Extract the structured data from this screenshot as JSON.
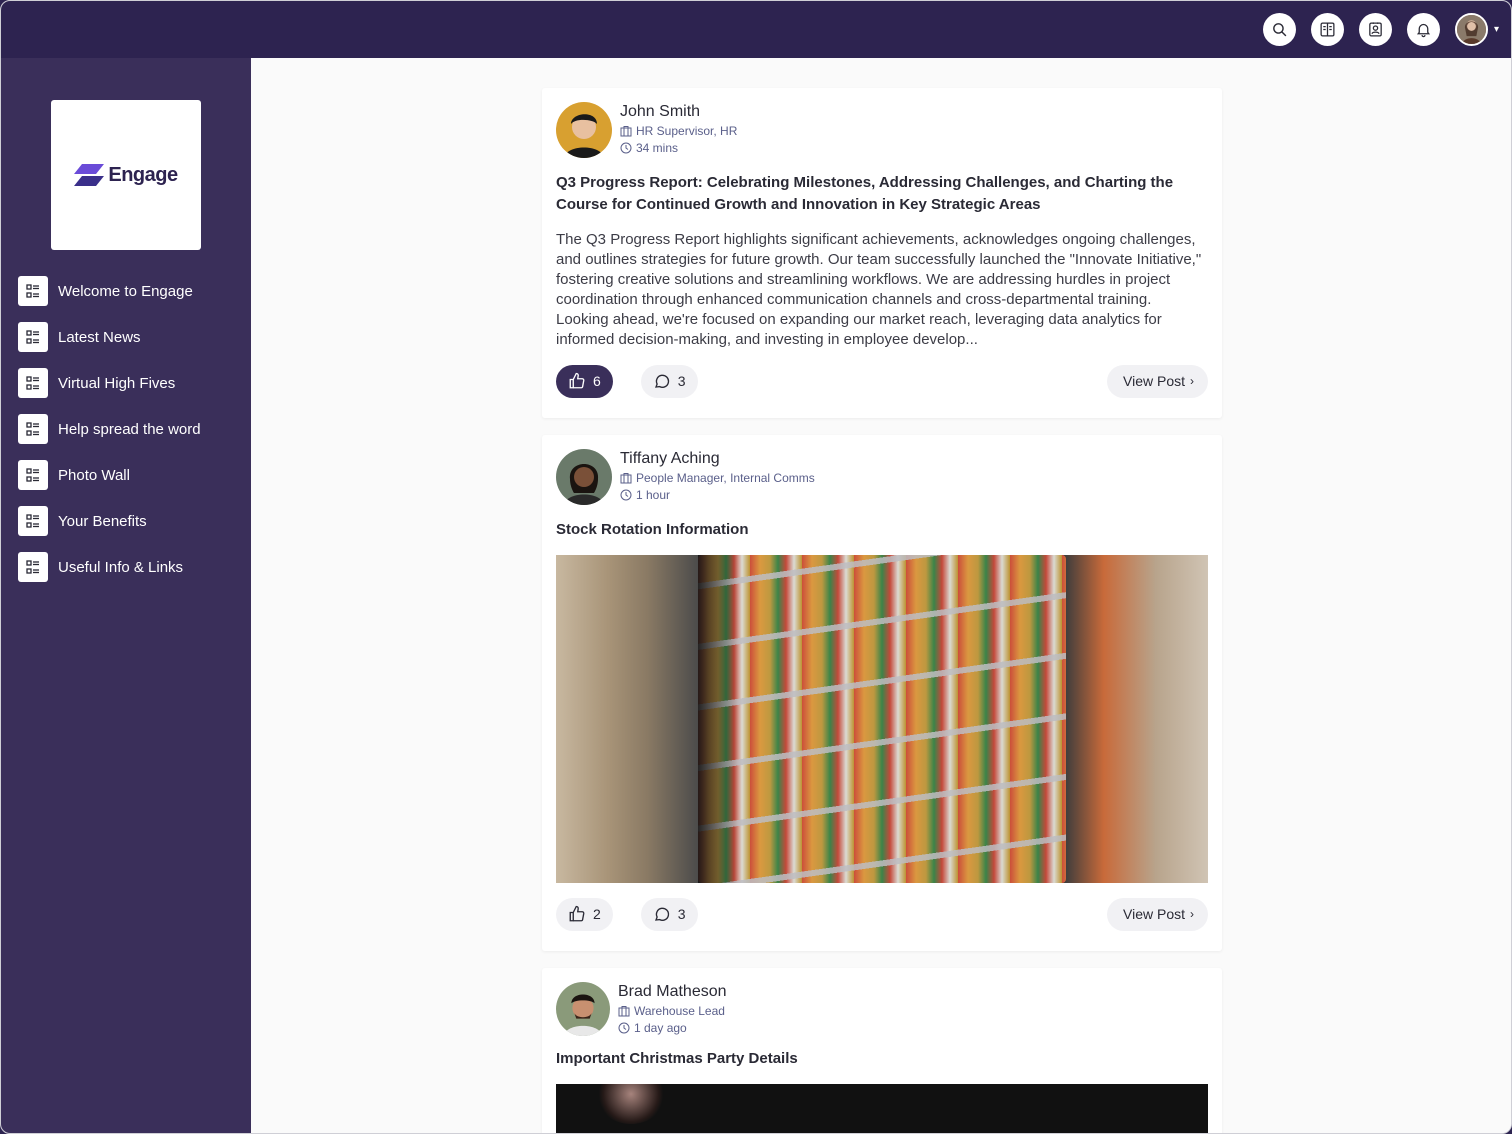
{
  "app": {
    "logo_text": "Engage"
  },
  "sidebar": {
    "items": [
      {
        "label": "Welcome to Engage"
      },
      {
        "label": "Latest News"
      },
      {
        "label": "Virtual High Fives"
      },
      {
        "label": "Help spread the word"
      },
      {
        "label": "Photo Wall"
      },
      {
        "label": "Your Benefits"
      },
      {
        "label": "Useful Info & Links"
      }
    ]
  },
  "topbar": {
    "icons": [
      "search-icon",
      "book-icon",
      "contact-card-icon",
      "bell-icon",
      "user-avatar"
    ],
    "caret": "▾"
  },
  "posts": [
    {
      "author": "John Smith",
      "role": "HR Supervisor, HR",
      "time": "34 mins",
      "title": "Q3 Progress Report: Celebrating Milestones, Addressing Challenges, and Charting the Course for Continued Growth and Innovation in Key Strategic Areas",
      "body": "The Q3 Progress Report highlights significant achievements, acknowledges ongoing challenges, and outlines strategies for future growth. Our team successfully launched the \"Innovate Initiative,\" fostering creative solutions and streamlining workflows. We are addressing hurdles in project coordination through enhanced communication channels and cross-departmental training. Looking ahead, we're focused on expanding our market reach, leveraging data analytics for informed decision-making, and investing in employee develop...",
      "likes": "6",
      "comments": "3",
      "liked": true,
      "view_label": "View Post"
    },
    {
      "author": "Tiffany Aching",
      "role": "People Manager, Internal Comms",
      "time": "1 hour",
      "title": "Stock Rotation Information",
      "likes": "2",
      "comments": "3",
      "liked": false,
      "view_label": "View Post"
    },
    {
      "author": "Brad Matheson",
      "role": "Warehouse Lead",
      "time": "1 day ago",
      "title": "Important Christmas Party Details"
    }
  ],
  "colors": {
    "brand_dark": "#2d2350",
    "sidebar": "#3a2f5a",
    "accent_logo": "#6a4bd8",
    "meta_text": "#5a5f8a"
  }
}
